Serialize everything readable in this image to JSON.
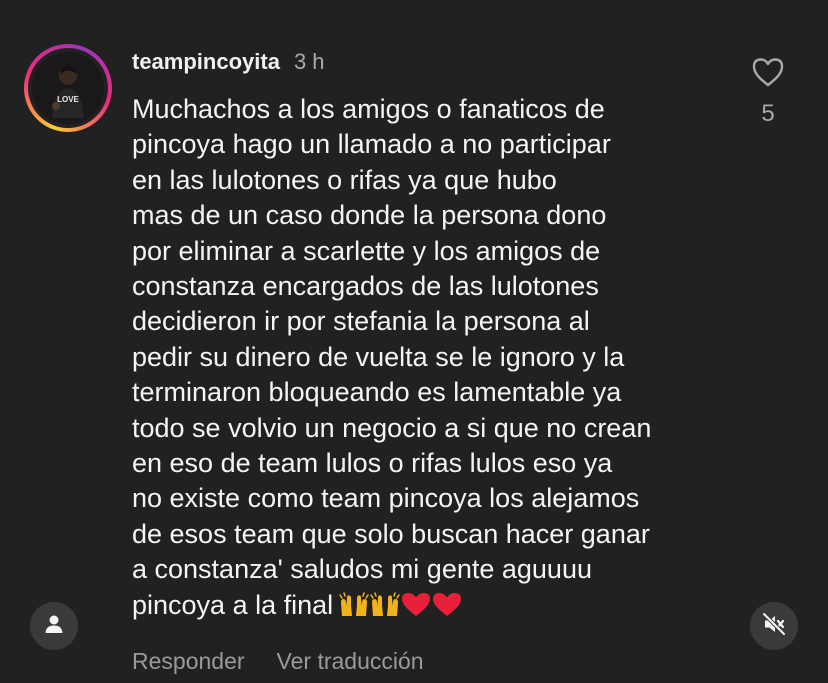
{
  "comment": {
    "username": "teampincoyita",
    "time": "3 h",
    "lines": [
      "Muchachos a los amigos o fanaticos de",
      "pincoya hago un llamado a no participar",
      "en las lulotones o rifas ya que hubo",
      "mas de un caso donde la persona dono",
      "por eliminar a scarlette y los amigos de",
      "constanza encargados de las lulotones",
      "decidieron ir por stefania la persona al",
      "pedir su dinero de vuelta se le ignoro y la",
      "terminaron bloqueando es lamentable ya",
      "todo se volvio un negocio a si que no crean",
      "en eso de team lulos o rifas lulos eso ya",
      "no existe como team pincoya los alejamos",
      "de esos team que solo buscan hacer ganar",
      "a constanza' saludos mi gente aguuuu",
      "pincoya a la final"
    ],
    "emojis": [
      "raising-hands-emoji",
      "raising-hands-emoji",
      "red-heart-emoji",
      "red-heart-emoji"
    ],
    "like_count": "5",
    "reply_label": "Responder",
    "translate_label": "Ver traducción"
  },
  "icons": {
    "like": "heart-outline-icon",
    "user": "person-icon",
    "mute": "speaker-muted-icon"
  },
  "colors": {
    "background": "#212121",
    "text": "#f5f5f5",
    "secondary_text": "#a8a8a8",
    "heart_emoji": "#e8203a",
    "hands_emoji": "#f2b21c"
  }
}
